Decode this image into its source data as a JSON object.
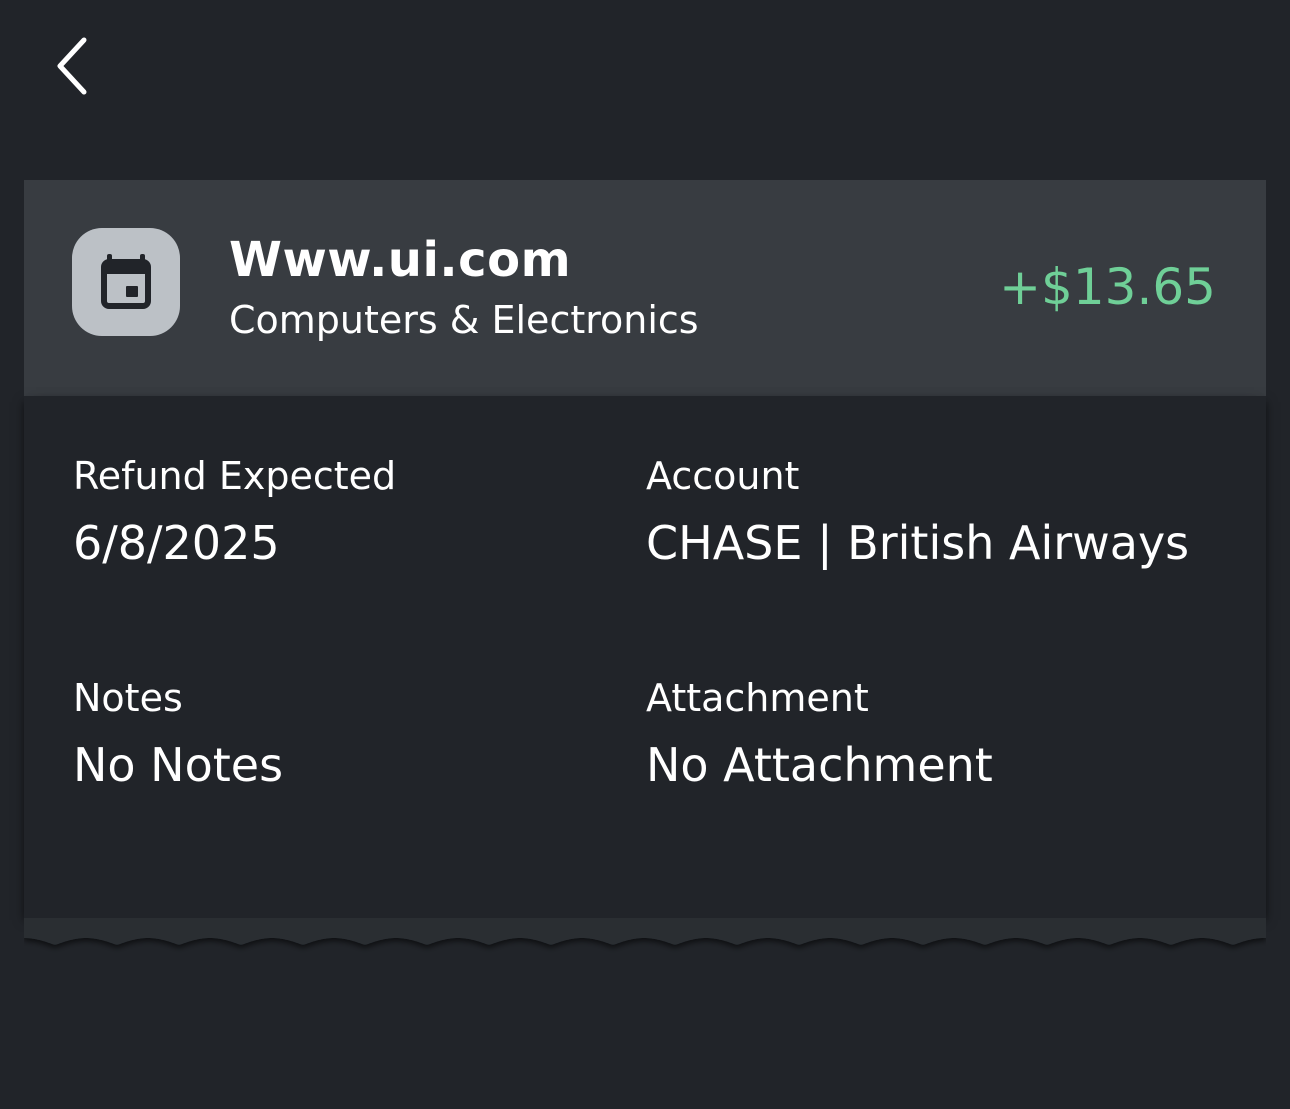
{
  "nav": {
    "back_icon": "chevron-left-icon"
  },
  "transaction": {
    "merchant": "Www.ui.com",
    "category": "Computers & Electronics",
    "amount": "+$13.65",
    "icon": "calendar-icon",
    "amount_color": "#6fcf97"
  },
  "details": {
    "refund_label": "Refund Expected",
    "refund_value": "6/8/2025",
    "account_label": "Account",
    "account_value": "CHASE | British Airways",
    "notes_label": "Notes",
    "notes_value": "No Notes",
    "attachment_label": "Attachment",
    "attachment_value": "No Attachment"
  },
  "colors": {
    "background": "#212429",
    "header_background": "#383c41",
    "icon_background": "#bcc1c6"
  }
}
